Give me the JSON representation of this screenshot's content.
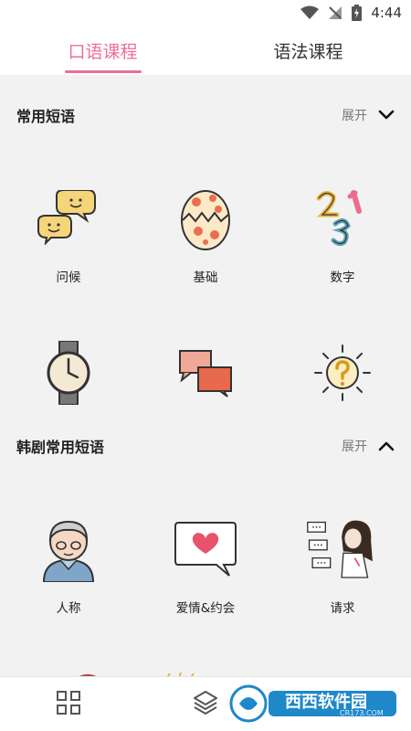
{
  "status": {
    "time": "4:44"
  },
  "tabs": [
    {
      "label": "口语课程",
      "active": true
    },
    {
      "label": "语法课程",
      "active": false
    }
  ],
  "sections": [
    {
      "title": "常用短语",
      "expand_label": "展开",
      "expanded": false,
      "items": [
        {
          "label": "问候",
          "icon": "speech-bubbles-icon"
        },
        {
          "label": "基础",
          "icon": "egg-icon"
        },
        {
          "label": "数字",
          "icon": "numbers-icon"
        },
        {
          "label": "",
          "icon": "watch-icon"
        },
        {
          "label": "",
          "icon": "chat-cards-icon"
        },
        {
          "label": "",
          "icon": "question-sun-icon"
        }
      ]
    },
    {
      "title": "韩剧常用短语",
      "expand_label": "展开",
      "expanded": true,
      "items": [
        {
          "label": "人称",
          "icon": "grandpa-icon"
        },
        {
          "label": "爱情&约会",
          "icon": "heart-bubble-icon"
        },
        {
          "label": "请求",
          "icon": "girl-talking-icon"
        }
      ]
    }
  ],
  "bottom_nav": [
    {
      "icon": "grid-icon"
    },
    {
      "icon": "layers-icon"
    },
    {
      "icon": "profile-icon"
    }
  ],
  "watermark": {
    "text": "西西软件园",
    "subtext": "CR173.COM"
  },
  "colors": {
    "accent": "#ec6f93",
    "background": "#f2f2f2"
  }
}
